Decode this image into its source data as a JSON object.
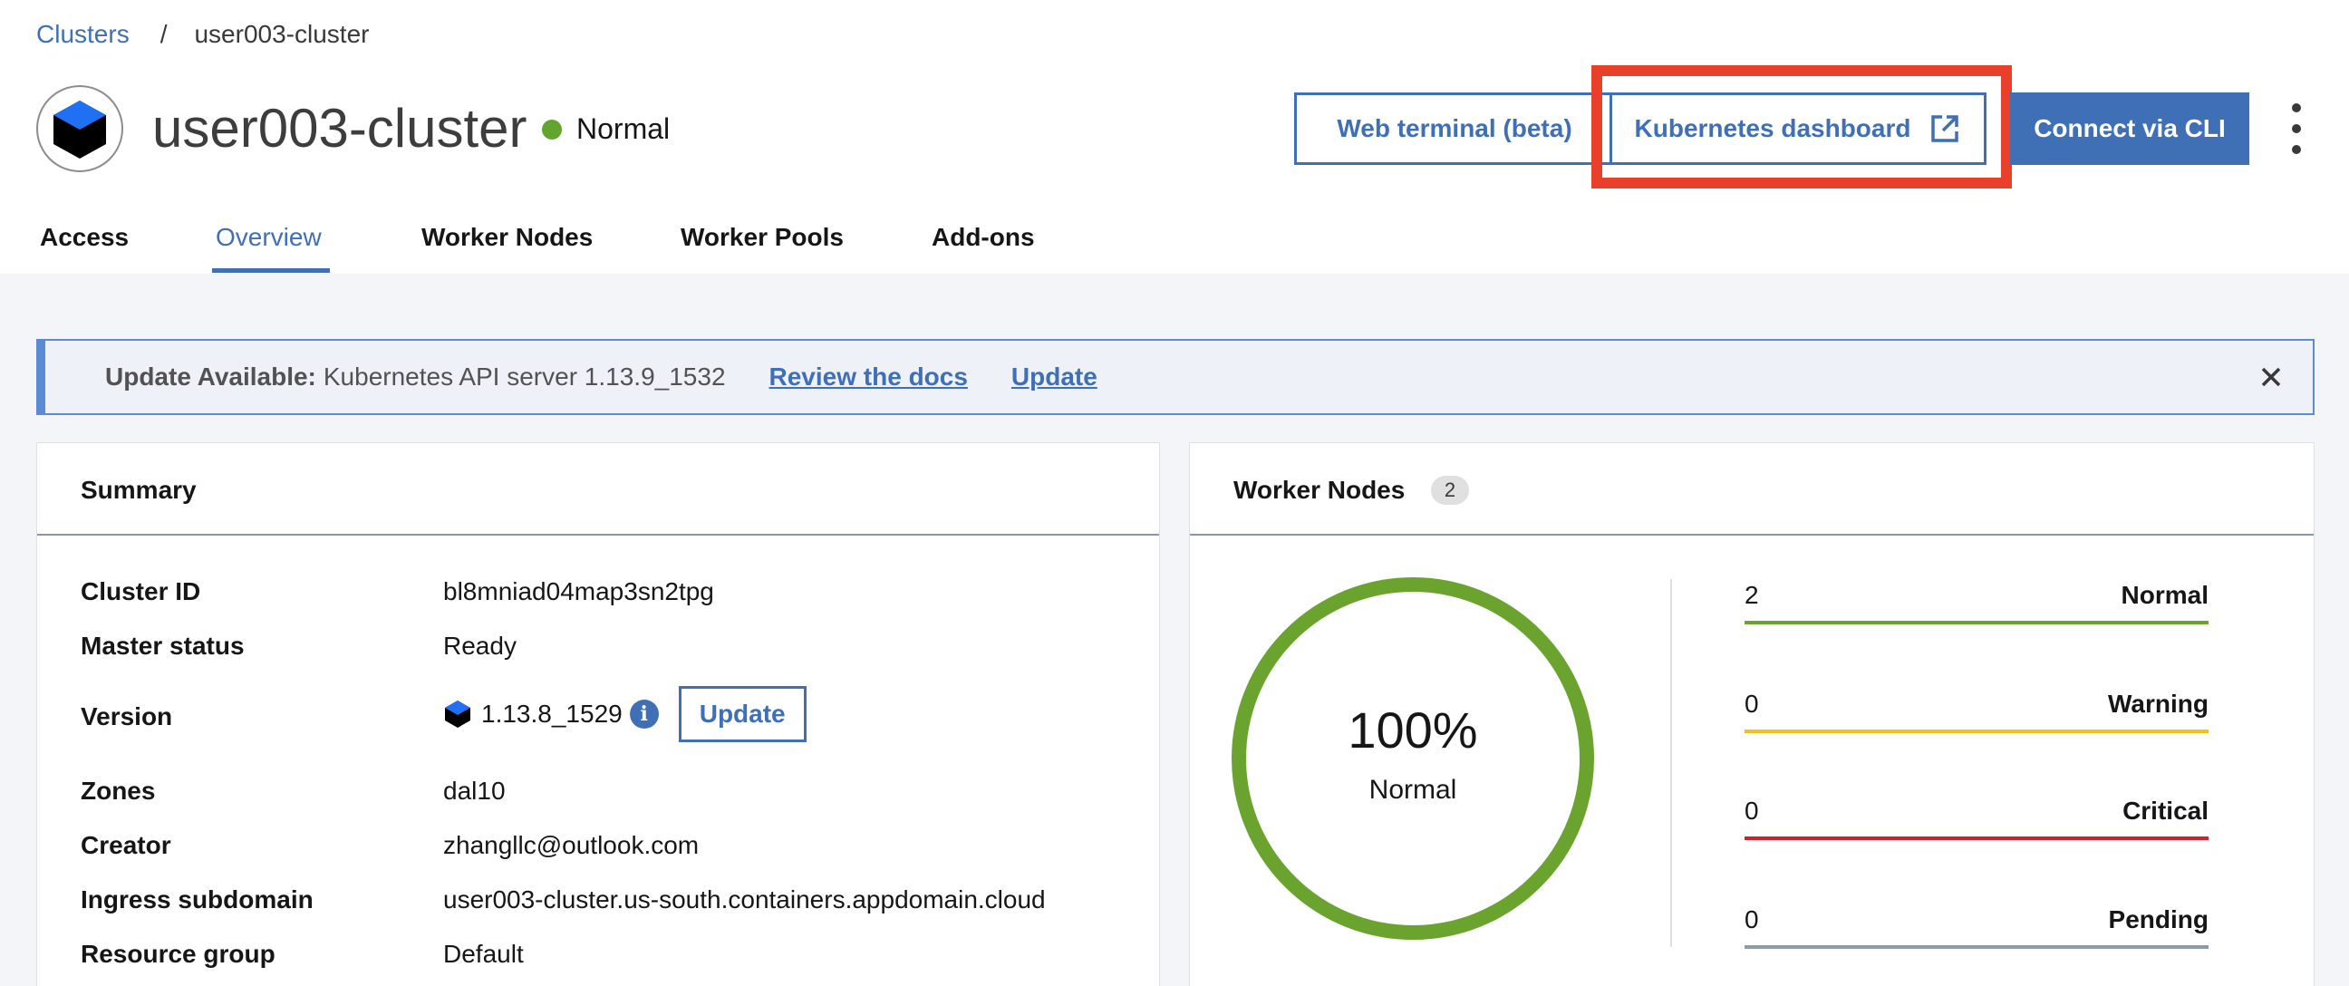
{
  "breadcrumb": {
    "root": "Clusters",
    "separator": "/",
    "current": "user003-cluster"
  },
  "header": {
    "title": "user003-cluster",
    "status": "Normal",
    "status_color": "#62a52e",
    "web_terminal_label": "Web terminal (beta)",
    "k8s_dashboard_label": "Kubernetes dashboard",
    "connect_cli_label": "Connect via CLI",
    "highlight_color": "#e8402a"
  },
  "tabs": [
    {
      "label": "Access"
    },
    {
      "label": "Overview",
      "active": true
    },
    {
      "label": "Worker Nodes"
    },
    {
      "label": "Worker Pools"
    },
    {
      "label": "Add-ons"
    }
  ],
  "banner": {
    "label": "Update Available:",
    "text": "Kubernetes API server 1.13.9_1532",
    "docs_link": "Review the docs",
    "update_link": "Update"
  },
  "summary": {
    "title": "Summary",
    "rows": [
      {
        "key": "Cluster ID",
        "value": "bl8mniad04map3sn2tpg"
      },
      {
        "key": "Master status",
        "value": "Ready"
      },
      {
        "key": "Version",
        "value": "1.13.8_1529",
        "button": "Update"
      },
      {
        "key": "Zones",
        "value": "dal10"
      },
      {
        "key": "Creator",
        "value": "zhangllc@outlook.com"
      },
      {
        "key": "Ingress subdomain",
        "value": "user003-cluster.us-south.containers.appdomain.cloud"
      },
      {
        "key": "Resource group",
        "value": "Default"
      }
    ]
  },
  "workers": {
    "title": "Worker Nodes",
    "count": "2",
    "percent": "100%",
    "percent_label": "Normal",
    "ring_color": "#6aa42f",
    "stats": [
      {
        "count": "2",
        "label": "Normal",
        "color": "#6aa42f"
      },
      {
        "count": "0",
        "label": "Warning",
        "color": "#f1c21b"
      },
      {
        "count": "0",
        "label": "Critical",
        "color": "#da1e28"
      },
      {
        "count": "0",
        "label": "Pending",
        "color": "#8d9aa8"
      }
    ]
  },
  "accent_color": "#3f6fb5"
}
